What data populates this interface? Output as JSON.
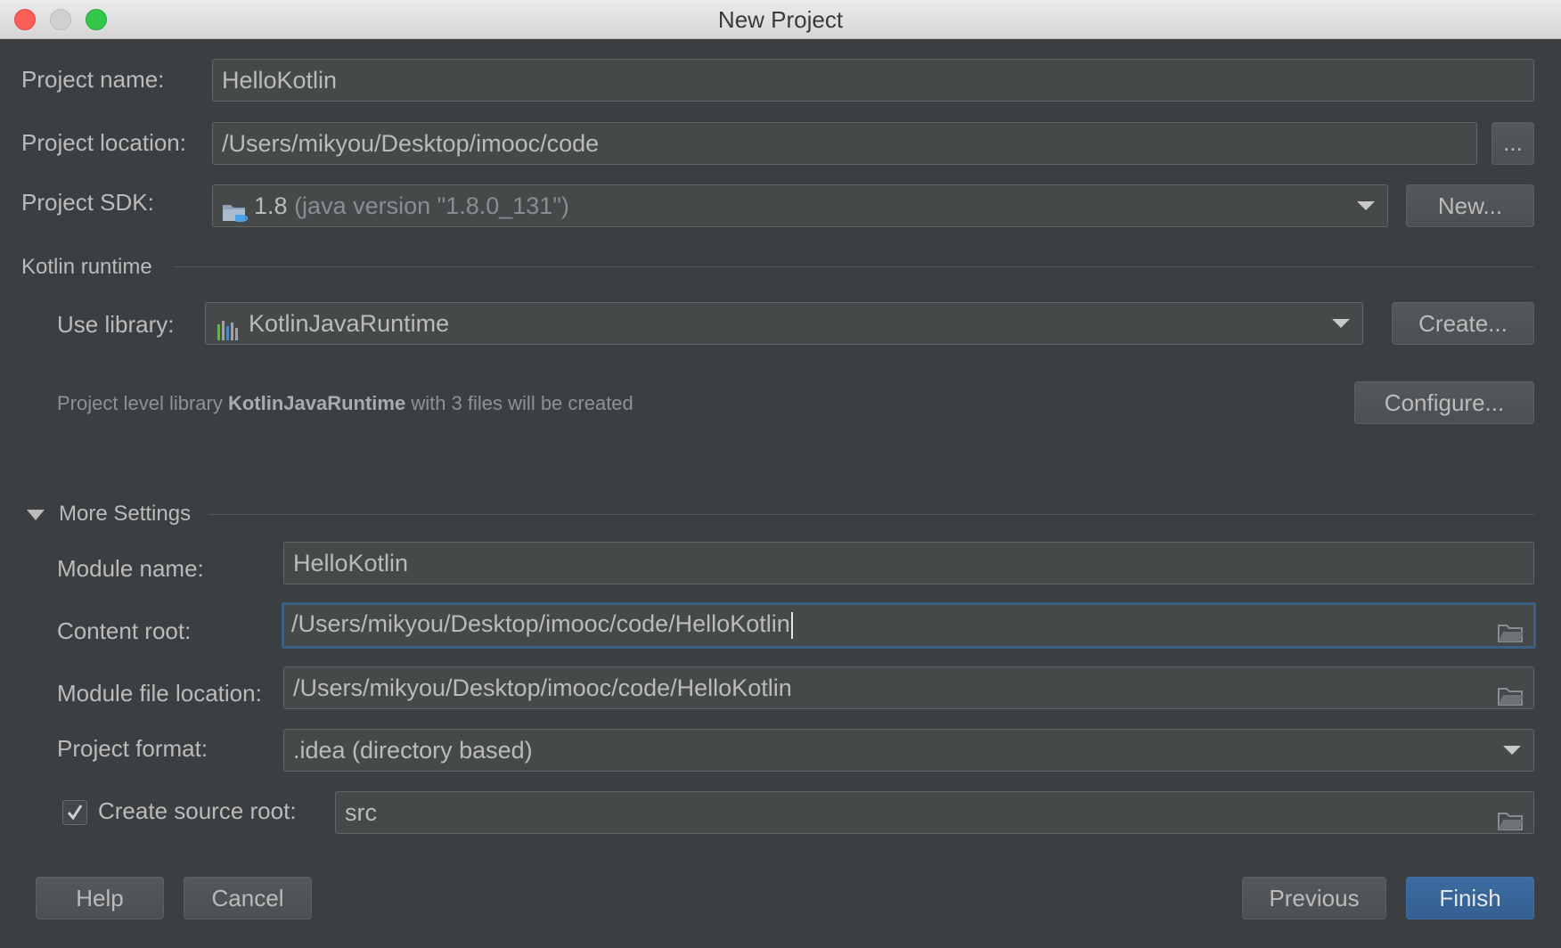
{
  "window": {
    "title": "New Project"
  },
  "project": {
    "name_label": "Project name:",
    "name_value": "HelloKotlin",
    "location_label": "Project location:",
    "location_value": "/Users/mikyou/Desktop/imooc/code",
    "browse_label": "...",
    "sdk_label": "Project SDK:",
    "sdk_version": "1.8",
    "sdk_detail": "(java version \"1.8.0_131\")",
    "sdk_new_button": "New..."
  },
  "kotlin_runtime": {
    "section_title": "Kotlin runtime",
    "use_library_label": "Use library:",
    "library_value": "KotlinJavaRuntime",
    "create_button": "Create...",
    "hint_prefix": "Project level library ",
    "hint_library": "KotlinJavaRuntime",
    "hint_suffix": " with 3 files will be created",
    "configure_button": "Configure..."
  },
  "more_settings": {
    "section_title": "More Settings",
    "module_name_label": "Module name:",
    "module_name_value": "HelloKotlin",
    "content_root_label": "Content root:",
    "content_root_value": "/Users/mikyou/Desktop/imooc/code/HelloKotlin",
    "module_file_label": "Module file location:",
    "module_file_value": "/Users/mikyou/Desktop/imooc/code/HelloKotlin",
    "project_format_label": "Project format:",
    "project_format_value": ".idea (directory based)",
    "create_source_root_label": "Create source root:",
    "create_source_root_checked": true,
    "source_root_value": "src"
  },
  "footer": {
    "help": "Help",
    "cancel": "Cancel",
    "previous": "Previous",
    "finish": "Finish"
  },
  "icons": {
    "sdk": "jdk-folder-icon",
    "library": "library-icon",
    "folder": "folder-icon",
    "expand": "triangle-down-icon",
    "check": "checkmark-icon"
  }
}
